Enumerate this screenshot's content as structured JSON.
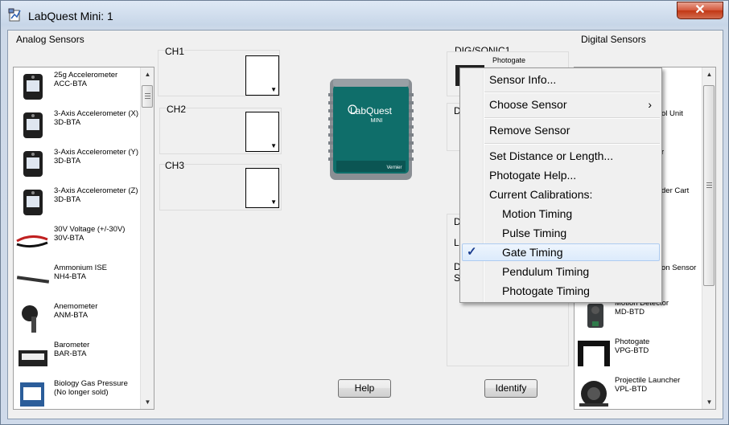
{
  "window": {
    "title": "LabQuest Mini: 1",
    "close_label": "✕"
  },
  "analog": {
    "label": "Analog Sensors",
    "items": [
      {
        "name": "25g Accelerometer",
        "code": "ACC-BTA"
      },
      {
        "name": "3-Axis Accelerometer (X)",
        "code": "3D-BTA"
      },
      {
        "name": "3-Axis Accelerometer (Y)",
        "code": "3D-BTA"
      },
      {
        "name": "3-Axis Accelerometer (Z)",
        "code": "3D-BTA"
      },
      {
        "name": "30V Voltage (+/-30V)",
        "code": "30V-BTA"
      },
      {
        "name": "Ammonium ISE",
        "code": "NH4-BTA"
      },
      {
        "name": "Anemometer",
        "code": "ANM-BTA"
      },
      {
        "name": "Barometer",
        "code": "BAR-BTA"
      },
      {
        "name": "Biology Gas Pressure",
        "code": "(No longer sold)"
      }
    ]
  },
  "channels": [
    {
      "label": "CH1"
    },
    {
      "label": "CH2"
    },
    {
      "label": "CH3"
    }
  ],
  "digital": {
    "label": "Digital Sensors",
    "port_label": "DIG/SONIC1",
    "port_sensor": "Photogate",
    "port2_label_partial": "D",
    "lower_box_label_partial": "D",
    "lower_box_text1": "La",
    "lower_box_text2": "D/",
    "lower_box_text3": "Se",
    "items_partial": [
      {
        "name": "ol Unit",
        "code": ""
      },
      {
        "name": "r",
        "code": ""
      },
      {
        "name": "der Cart",
        "code": ""
      },
      {
        "name": "on Sensor",
        "code": ""
      }
    ],
    "items": [
      {
        "name": "Motion Detector",
        "code": "MD-BTD"
      },
      {
        "name": "Photogate",
        "code": "VPG-BTD"
      },
      {
        "name": "Projectile Launcher",
        "code": "VPL-BTD"
      }
    ]
  },
  "buttons": {
    "help": "Help",
    "identify": "Identify"
  },
  "device": {
    "brand": "LabQuest",
    "model": "MINI",
    "maker": "Vernier"
  },
  "context_menu": {
    "items": [
      {
        "label": "Sensor Info..."
      },
      {
        "label": "Choose Sensor",
        "arrow": "›"
      },
      {
        "label": "Remove Sensor"
      },
      {
        "label": "Set Distance or Length..."
      },
      {
        "label": "Photogate Help..."
      },
      {
        "label": "Current Calibrations:"
      }
    ],
    "calibrations": [
      {
        "label": "Motion Timing"
      },
      {
        "label": "Pulse Timing"
      },
      {
        "label": "Gate Timing",
        "checked": true,
        "check": "✓"
      },
      {
        "label": "Pendulum Timing"
      },
      {
        "label": "Photogate Timing"
      }
    ]
  },
  "colors": {
    "device_body": "#0f6e6a",
    "checkmark": "#1a3d8f",
    "close_red": "#c7391b"
  }
}
